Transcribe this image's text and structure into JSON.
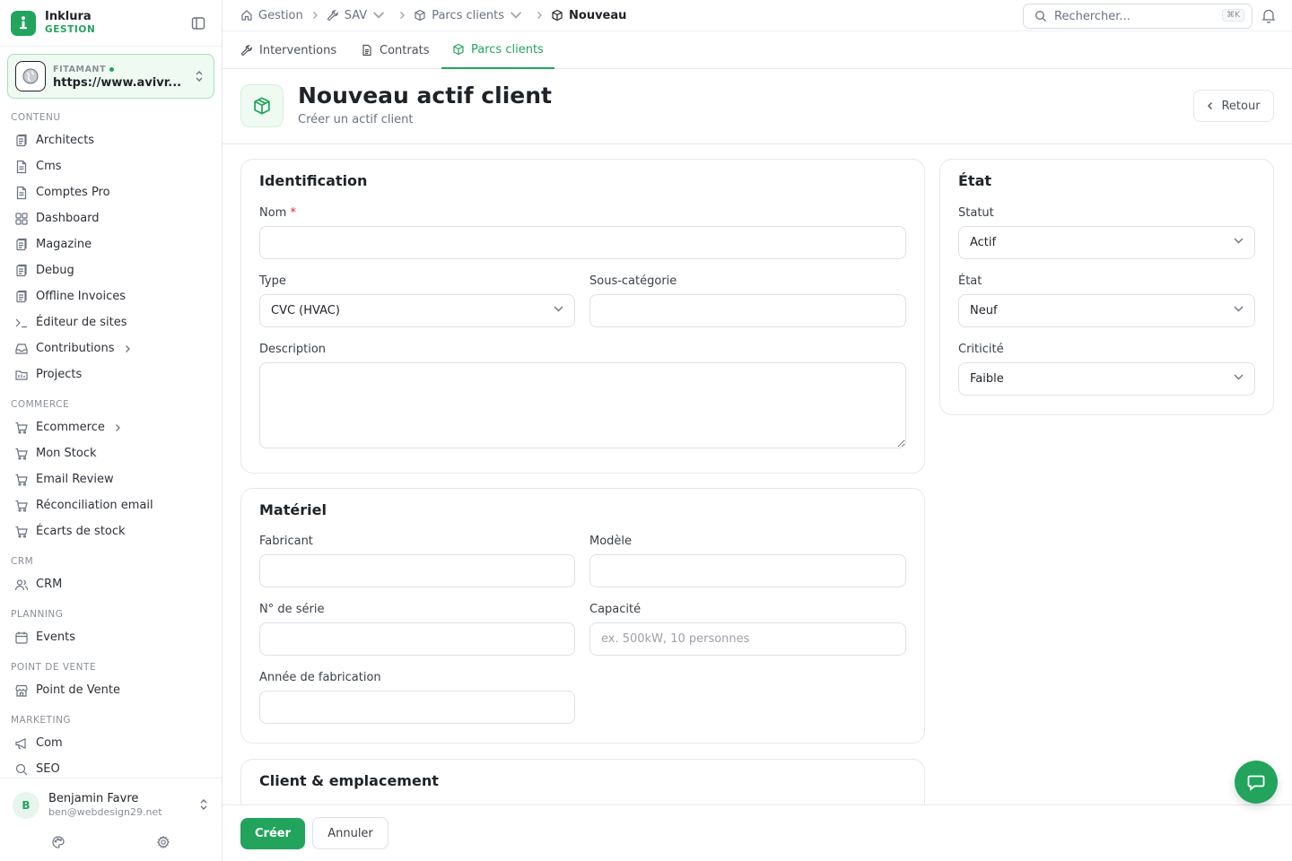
{
  "brand": {
    "name": "Inklura",
    "sub": "GESTION"
  },
  "site": {
    "label": "FITAMANT",
    "url": "https://www.avivr..."
  },
  "sidebar": {
    "sections": [
      {
        "title": "CONTENU",
        "items": [
          {
            "label": "Architects",
            "icon": "document-stack-icon"
          },
          {
            "label": "Cms",
            "icon": "document-icon"
          },
          {
            "label": "Comptes Pro",
            "icon": "document-icon"
          },
          {
            "label": "Dashboard",
            "icon": "grid-icon"
          },
          {
            "label": "Magazine",
            "icon": "document-stack-icon"
          },
          {
            "label": "Debug",
            "icon": "document-stack-icon"
          },
          {
            "label": "Offline Invoices",
            "icon": "document-stack-icon"
          },
          {
            "label": "Éditeur de sites",
            "icon": "terminal-icon"
          },
          {
            "label": "Contributions",
            "icon": "inbox-icon",
            "expandable": true
          },
          {
            "label": "Projects",
            "icon": "folder-icon"
          }
        ]
      },
      {
        "title": "COMMERCE",
        "items": [
          {
            "label": "Ecommerce",
            "icon": "cart-icon",
            "expandable": true
          },
          {
            "label": "Mon Stock",
            "icon": "cart-icon"
          },
          {
            "label": "Email Review",
            "icon": "cart-icon"
          },
          {
            "label": "Réconciliation email",
            "icon": "cart-icon"
          },
          {
            "label": "Écarts de stock",
            "icon": "cart-icon"
          }
        ]
      },
      {
        "title": "CRM",
        "items": [
          {
            "label": "CRM",
            "icon": "users-icon"
          }
        ]
      },
      {
        "title": "PLANNING",
        "items": [
          {
            "label": "Events",
            "icon": "calendar-icon"
          }
        ]
      },
      {
        "title": "POINT DE VENTE",
        "items": [
          {
            "label": "Point de Vente",
            "icon": "store-icon"
          }
        ]
      },
      {
        "title": "MARKETING",
        "items": [
          {
            "label": "Com",
            "icon": "megaphone-icon"
          },
          {
            "label": "SEO",
            "icon": "search-icon"
          }
        ]
      }
    ]
  },
  "user": {
    "initial": "B",
    "name": "Benjamin Favre",
    "email": "ben@webdesign29.net"
  },
  "breadcrumb": {
    "home": "Gestion",
    "sav": "SAV",
    "parcs": "Parcs clients",
    "current": "Nouveau"
  },
  "search": {
    "placeholder": "Rechercher...",
    "shortcut": "⌘K"
  },
  "tabs": [
    {
      "label": "Interventions",
      "icon": "wrench-icon",
      "active": false
    },
    {
      "label": "Contrats",
      "icon": "document-icon",
      "active": false
    },
    {
      "label": "Parcs clients",
      "icon": "box-icon",
      "active": true
    }
  ],
  "page": {
    "title": "Nouveau actif client",
    "subtitle": "Créer un actif client",
    "back_label": "Retour"
  },
  "identification": {
    "title": "Identification",
    "nom_label": "Nom",
    "required_mark": "*",
    "nom_value": "",
    "type_label": "Type",
    "type_value": "CVC (HVAC)",
    "souscat_label": "Sous-catégorie",
    "souscat_value": "",
    "description_label": "Description",
    "description_value": ""
  },
  "materiel": {
    "title": "Matériel",
    "fabricant_label": "Fabricant",
    "fabricant_value": "",
    "modele_label": "Modèle",
    "modele_value": "",
    "serie_label": "N° de série",
    "serie_value": "",
    "capacite_label": "Capacité",
    "capacite_placeholder": "ex. 500kW, 10 personnes",
    "capacite_value": "",
    "annee_label": "Année de fabrication",
    "annee_value": ""
  },
  "client": {
    "title": "Client & emplacement"
  },
  "etat_card": {
    "title": "État",
    "statut_label": "Statut",
    "statut_value": "Actif",
    "etat_label": "État",
    "etat_value": "Neuf",
    "criticite_label": "Criticité",
    "criticite_value": "Faible"
  },
  "actions": {
    "create_label": "Créer",
    "cancel_label": "Annuler"
  },
  "colors": {
    "accent": "#22a45d",
    "required": "#dc2626"
  }
}
